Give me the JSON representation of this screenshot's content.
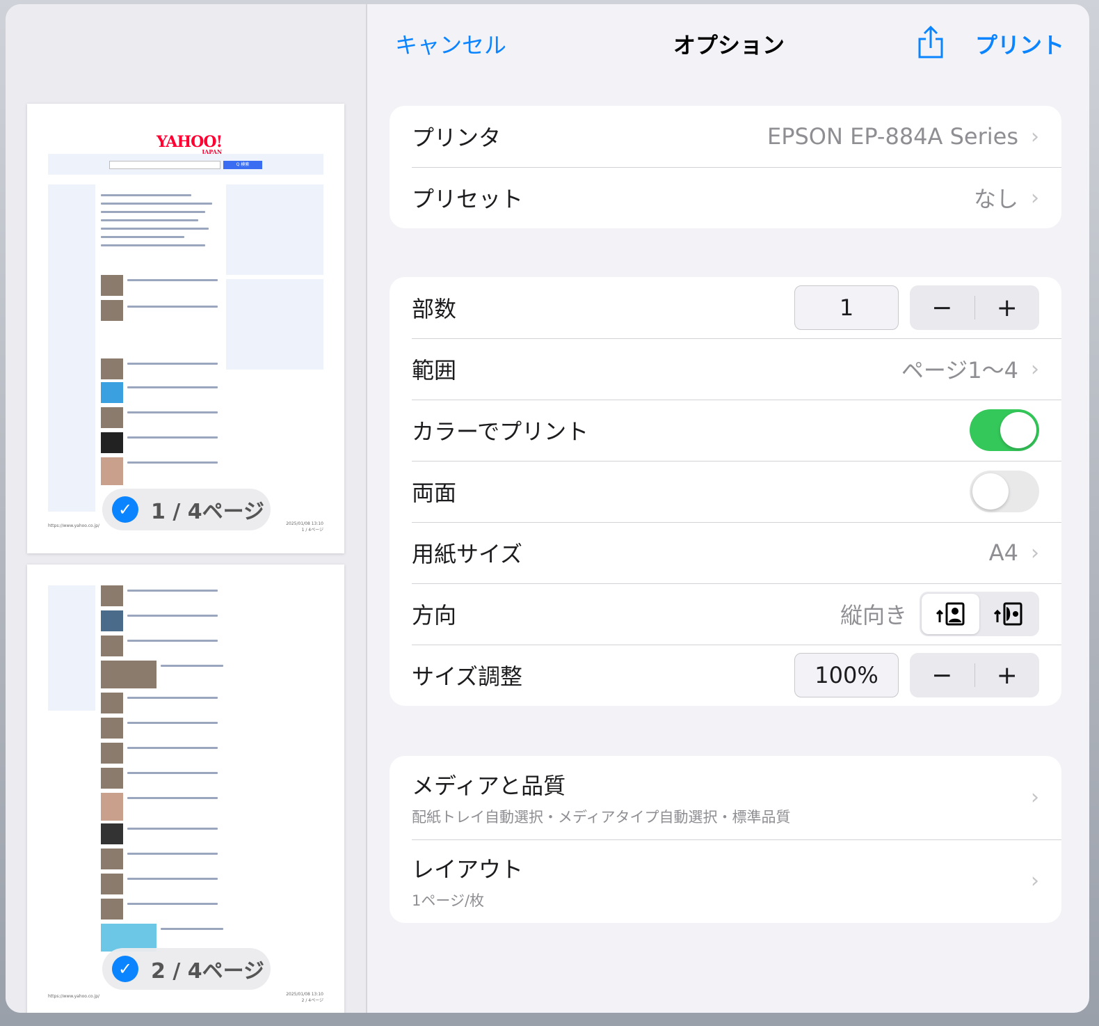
{
  "header": {
    "cancel": "キャンセル",
    "title": "オプション",
    "print": "プリント"
  },
  "printer": {
    "label": "プリンタ",
    "value": "EPSON EP-884A Series"
  },
  "preset": {
    "label": "プリセット",
    "value": "なし"
  },
  "copies": {
    "label": "部数",
    "value": "1"
  },
  "range": {
    "label": "範囲",
    "value": "ページ1〜4"
  },
  "color": {
    "label": "カラーでプリント",
    "on": true
  },
  "duplex": {
    "label": "両面",
    "on": false
  },
  "paper": {
    "label": "用紙サイズ",
    "value": "A4"
  },
  "orientation": {
    "label": "方向",
    "value": "縦向き"
  },
  "scale": {
    "label": "サイズ調整",
    "value": "100%"
  },
  "stepper": {
    "minus": "−",
    "plus": "+"
  },
  "media": {
    "label": "メディアと品質",
    "detail": "配紙トレイ自動選択・メディアタイプ自動選択・標準品質"
  },
  "layout": {
    "label": "レイアウト",
    "detail": "1ページ/枚"
  },
  "previews": [
    {
      "badge": "1 / 4ページ",
      "logo": "YAHOO!",
      "logo_sub": "JAPAN",
      "search_btn": "Q 検索",
      "url": "https://www.yahoo.co.jp/",
      "date": "2025/01/08 13:10",
      "page": "1 / 4ページ"
    },
    {
      "badge": "2 / 4ページ",
      "url": "https://www.yahoo.co.jp/",
      "date": "2025/01/08 13:10",
      "page": "2 / 4ページ"
    }
  ],
  "colors": {
    "accent": "#0a84ff",
    "toggle_on": "#34c759"
  }
}
